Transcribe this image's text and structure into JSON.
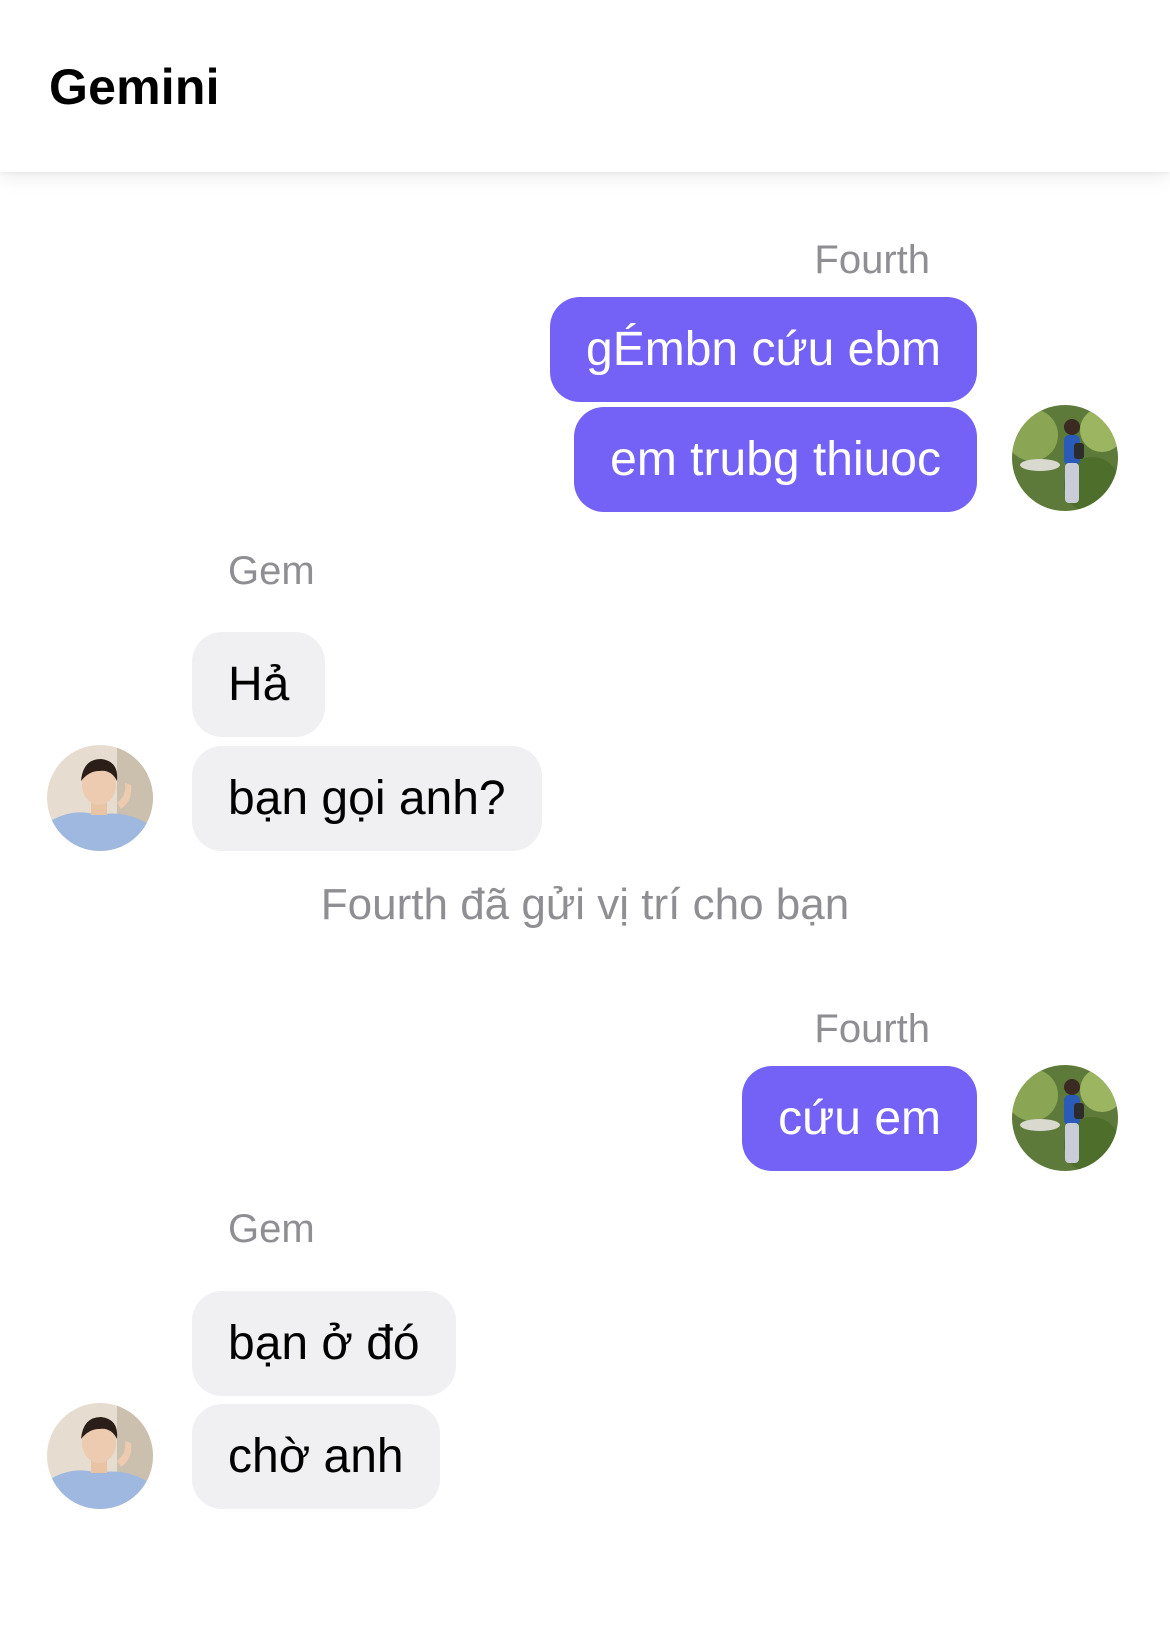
{
  "header": {
    "title": "Gemini"
  },
  "colors": {
    "outgoing_bubble": "#7461f5",
    "incoming_bubble": "#f0f0f2",
    "sender_label": "#8e8e93"
  },
  "messages": [
    {
      "sender": "Fourth",
      "direction": "outgoing",
      "texts": [
        "gÉmbn cứu ebm",
        "em trubg thiuoc"
      ],
      "avatar": "avatar-fourth"
    },
    {
      "sender": "Gem",
      "direction": "incoming",
      "texts": [
        "Hả",
        "bạn gọi anh?"
      ],
      "avatar": "avatar-gem"
    },
    {
      "system": "Fourth đã gửi vị trí cho bạn"
    },
    {
      "sender": "Fourth",
      "direction": "outgoing",
      "texts": [
        "cứu em"
      ],
      "avatar": "avatar-fourth"
    },
    {
      "sender": "Gem",
      "direction": "incoming",
      "texts": [
        "bạn ở đó",
        "chờ anh"
      ],
      "avatar": "avatar-gem"
    }
  ]
}
